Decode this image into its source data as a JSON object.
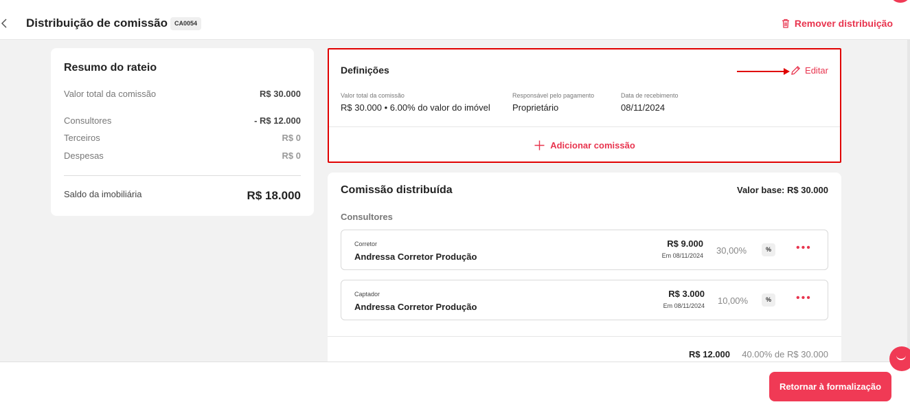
{
  "header": {
    "title": "Distribuição de comissão",
    "code": "CA0054",
    "remove_label": "Remover distribuição"
  },
  "summary": {
    "title": "Resumo do rateio",
    "rows": [
      {
        "label": "Valor total da comissão",
        "value": "R$ 30.000"
      },
      {
        "label": "Consultores",
        "value": "- R$ 12.000"
      },
      {
        "label": "Terceiros",
        "value": "R$ 0"
      },
      {
        "label": "Despesas",
        "value": "R$ 0"
      }
    ],
    "balance": {
      "label": "Saldo da imobiliária",
      "value": "R$ 18.000"
    }
  },
  "definitions": {
    "title": "Definições",
    "edit_label": "Editar",
    "fields": [
      {
        "label": "Valor total da comissão",
        "value": "R$ 30.000 • 6.00% do valor do imóvel"
      },
      {
        "label": "Responsável pelo pagamento",
        "value": "Proprietário"
      },
      {
        "label": "Data de recebimento",
        "value": "08/11/2024"
      }
    ],
    "add_label": "Adicionar comissão"
  },
  "distributed": {
    "title": "Comissão distribuída",
    "base": "Valor base: R$ 30.000",
    "section": "Consultores",
    "items": [
      {
        "role": "Corretor",
        "name": "Andressa Corretor Produção",
        "amount": "R$ 9.000",
        "date": "Em 08/11/2024",
        "percent": "30,00%",
        "badge": "%"
      },
      {
        "role": "Captador",
        "name": "Andressa Corretor Produção",
        "amount": "R$ 3.000",
        "date": "Em 08/11/2024",
        "percent": "10,00%",
        "badge": "%"
      }
    ],
    "total_amount": "R$ 12.000",
    "total_percent": "40.00% de R$ 30.000"
  },
  "footer": {
    "return_label": "Retornar à formalização"
  },
  "colors": {
    "accent": "#f03a55",
    "highlight_border": "#e00000"
  }
}
